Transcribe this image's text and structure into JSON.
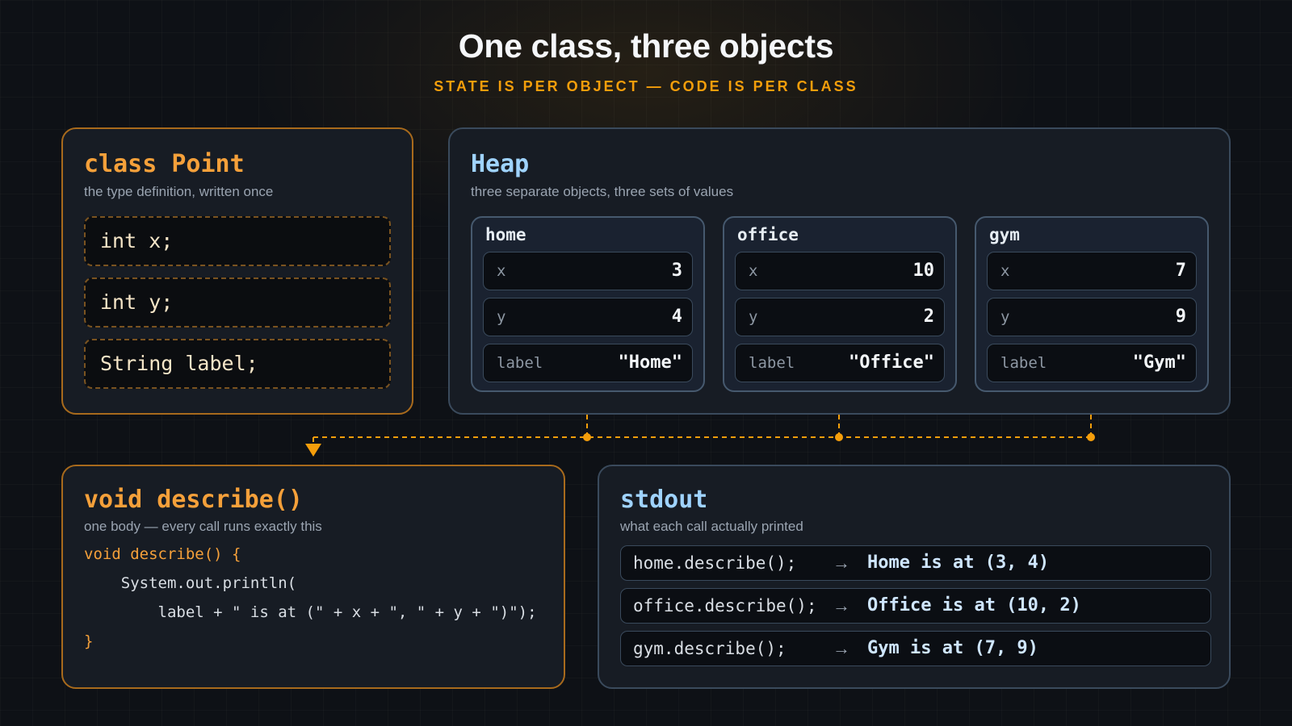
{
  "header": {
    "title": "One class, three objects",
    "subtitle": "STATE IS PER OBJECT — CODE IS PER CLASS"
  },
  "class_panel": {
    "title": "class Point",
    "description": "the type definition, written once",
    "fields": [
      "int x;",
      "int y;",
      "String label;"
    ]
  },
  "heap_panel": {
    "title": "Heap",
    "description": "three separate objects, three sets of values",
    "objects": [
      {
        "name": "home",
        "fields": [
          {
            "key": "x",
            "value": "3"
          },
          {
            "key": "y",
            "value": "4"
          },
          {
            "key": "label",
            "value": "\"Home\""
          }
        ]
      },
      {
        "name": "office",
        "fields": [
          {
            "key": "x",
            "value": "10"
          },
          {
            "key": "y",
            "value": "2"
          },
          {
            "key": "label",
            "value": "\"Office\""
          }
        ]
      },
      {
        "name": "gym",
        "fields": [
          {
            "key": "x",
            "value": "7"
          },
          {
            "key": "y",
            "value": "9"
          },
          {
            "key": "label",
            "value": "\"Gym\""
          }
        ]
      }
    ]
  },
  "method_panel": {
    "title": "void describe()",
    "description": "one body — every call runs exactly this",
    "code": [
      "void describe() {",
      "    System.out.println(",
      "        label + \" is at (\" + x + \", \" + y + \")\");",
      "}"
    ]
  },
  "stdout_panel": {
    "title": "stdout",
    "description": "what each call actually printed",
    "arrow": "→",
    "lines": [
      {
        "call": "home.describe();",
        "output": "Home is at (3, 4)"
      },
      {
        "call": "office.describe();",
        "output": "Office is at (10, 2)"
      },
      {
        "call": "gym.describe();",
        "output": "Gym is at (7, 9)"
      }
    ]
  },
  "colors": {
    "accent": "#f59e0b",
    "class_border": "#a86a1c",
    "heap_border": "#3a4a5c",
    "background": "#0e1116"
  }
}
